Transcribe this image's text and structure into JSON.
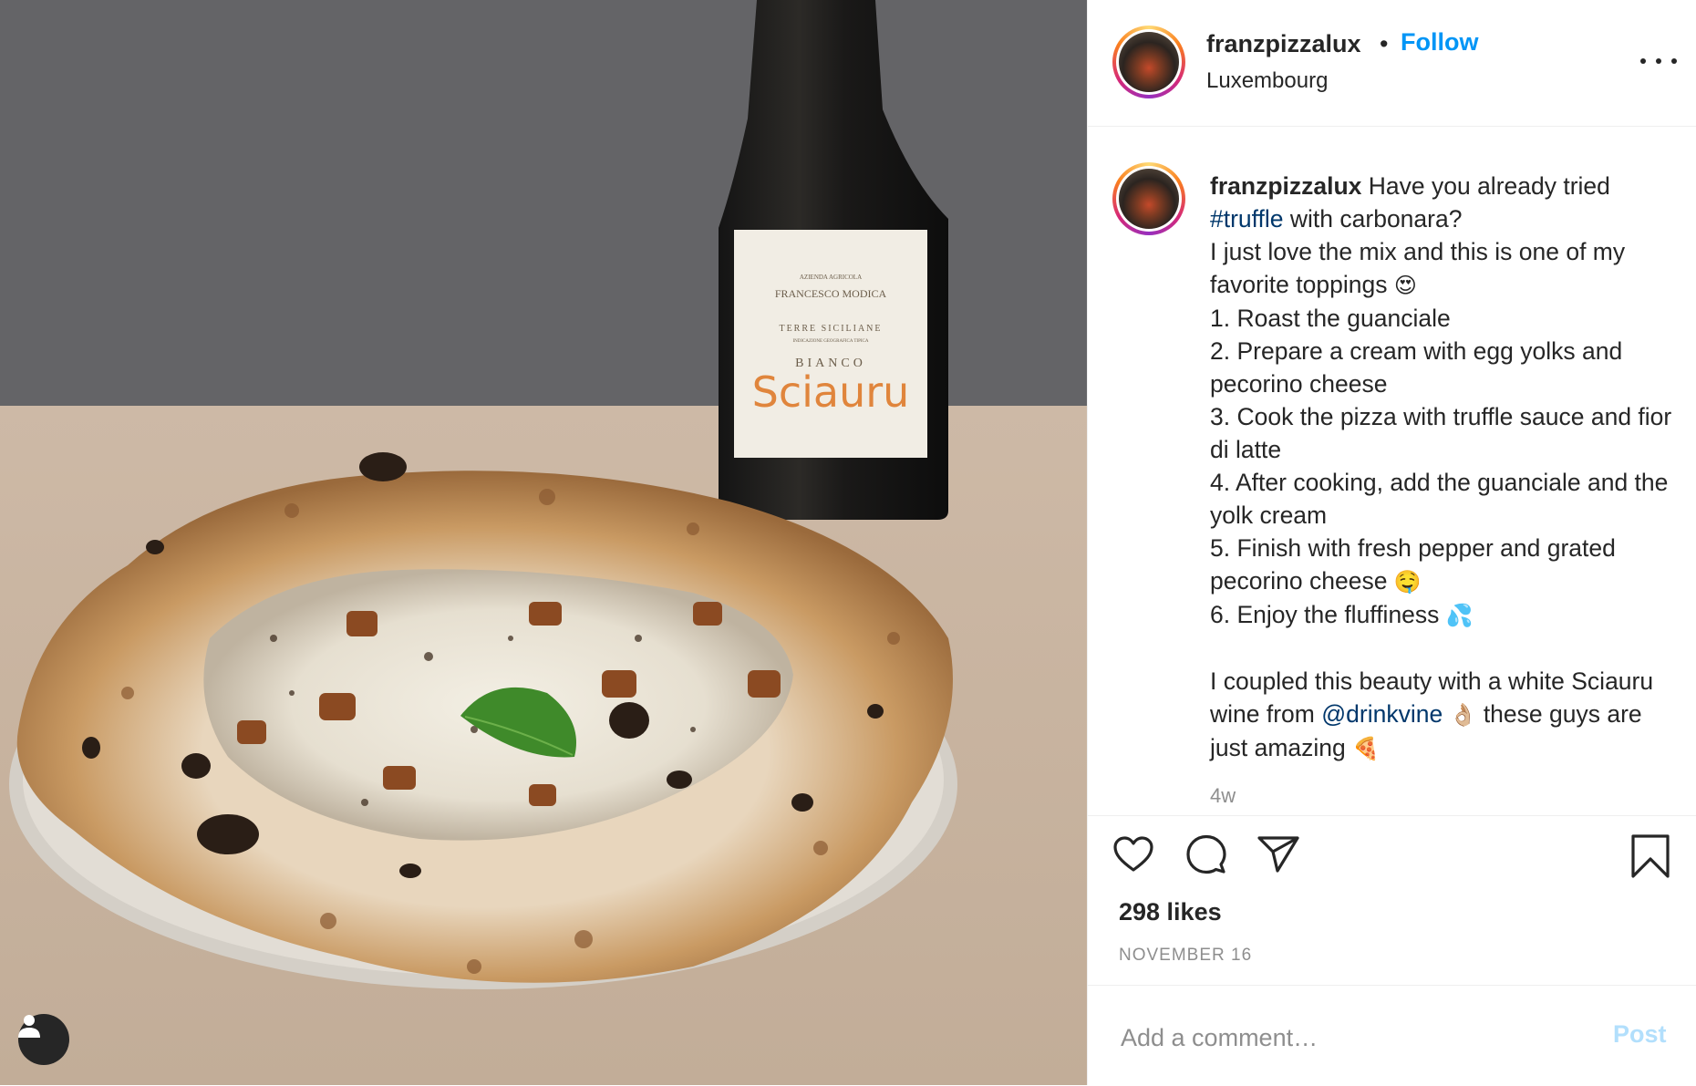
{
  "post": {
    "username": "franzpizzalux",
    "separator": "•",
    "follow_label": "Follow",
    "location": "Luxembourg",
    "more_icon": "more-options-icon"
  },
  "photo": {
    "label": {
      "line1": "AZIENDA AGRICOLA",
      "line2": "FRANCESCO MODICA",
      "line3": "TERRE SICILIANE",
      "line4": "INDICAZIONE GEOGRAFICA TIPICA",
      "line5": "BIANCO",
      "wine_name": "Sciauru"
    },
    "tag_icon": "user-tag-icon"
  },
  "caption": {
    "username": "franzpizzalux",
    "intro": " Have you already tried",
    "hashtag": "#truffle",
    "after_hashtag": " with carbonara?",
    "line2": "I just love the mix and this is one of my favorite toppings",
    "line2_emoji": "😍",
    "step1": "1. Roast the guanciale",
    "step2": "2. Prepare a cream with egg yolks and pecorino cheese",
    "step3": "3. Cook the pizza with truffle sauce and fior di latte",
    "step4": "4. After cooking, add the guanciale and the yolk cream",
    "step5": "5. Finish with fresh pepper and grated pecorino cheese",
    "step5_emoji": "🤤",
    "step6": "6. Enjoy the fluffiness",
    "step6_emoji": "💦",
    "outro_before": "I coupled this beauty with a white Sciauru wine from ",
    "mention": "@drinkvine",
    "outro_emoji": "👌🏼",
    "outro_after": " these guys are just amazing",
    "outro_end_emoji": "🍕",
    "time_ago": "4w"
  },
  "actions": {
    "like_icon": "heart-icon",
    "comment_icon": "comment-icon",
    "share_icon": "share-icon",
    "save_icon": "bookmark-icon",
    "likes": "298 likes",
    "date": "NOVEMBER 16"
  },
  "comment_box": {
    "placeholder": "Add a comment…",
    "post_label": "Post"
  },
  "colors": {
    "accent": "#0095f6",
    "link": "#00376b",
    "post_disabled": "#b2dffc",
    "muted": "#8e8e8e"
  }
}
